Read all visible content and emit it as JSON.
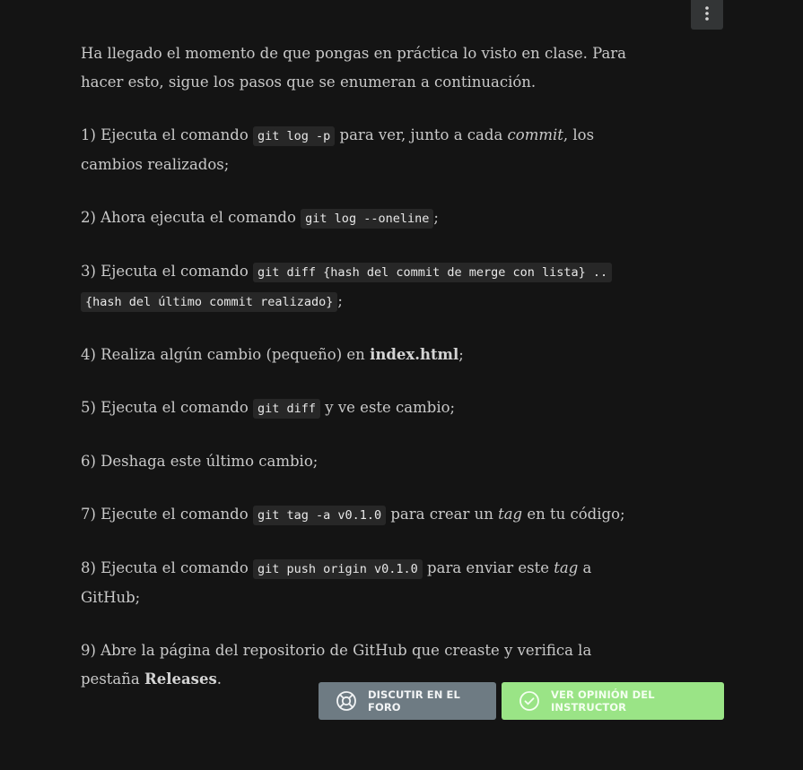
{
  "toolbar": {
    "menu_icon": "kebab-vertical-icon"
  },
  "content": {
    "intro": "Ha llegado el momento de que pongas en práctica lo visto en clase. Para hacer esto, sigue los pasos que se enumeran a continuación.",
    "step1": {
      "pre": "1) Ejecuta el comando ",
      "code": "git log -p",
      "mid": " para ver, junto a cada ",
      "em": "commit",
      "post": ", los cambios realizados;"
    },
    "step2": {
      "pre": "2) Ahora ejecuta el comando ",
      "code": "git log --oneline",
      "post": ";"
    },
    "step3": {
      "pre": "3) Ejecuta el comando ",
      "code1": "git diff {hash del commit de merge con lista} ..",
      "code2": "{hash del último commit realizado}",
      "post": ";"
    },
    "step4": {
      "pre": "4) Realiza algún cambio (pequeño) en ",
      "strong": "index.html",
      "post": ";"
    },
    "step5": {
      "pre": "5) Ejecuta el comando ",
      "code": "git diff",
      "post": " y ve este cambio;"
    },
    "step6": {
      "text": "6) Deshaga este último cambio;"
    },
    "step7": {
      "pre": "7) Ejecute el comando ",
      "code": "git tag -a v0.1.0",
      "mid": " para crear un ",
      "em": "tag",
      "post": " en tu código;"
    },
    "step8": {
      "pre": "8) Ejecuta el comando ",
      "code": "git push origin v0.1.0",
      "mid": " para enviar este ",
      "em": "tag",
      "post": " a GitHub;"
    },
    "step9": {
      "pre": "9) Abre la página del repositorio de GitHub que creaste y verifica la pestaña ",
      "strong": "Releases",
      "post": "."
    }
  },
  "actions": {
    "forum_label": "DISCUTIR EN EL FORO",
    "forum_icon": "lifebuoy-icon",
    "instructor_label": "VER OPINIÓN DEL INSTRUCTOR",
    "instructor_icon": "check-circle-icon",
    "forum_color": "#6e7b83",
    "instructor_color": "#9ae486"
  }
}
